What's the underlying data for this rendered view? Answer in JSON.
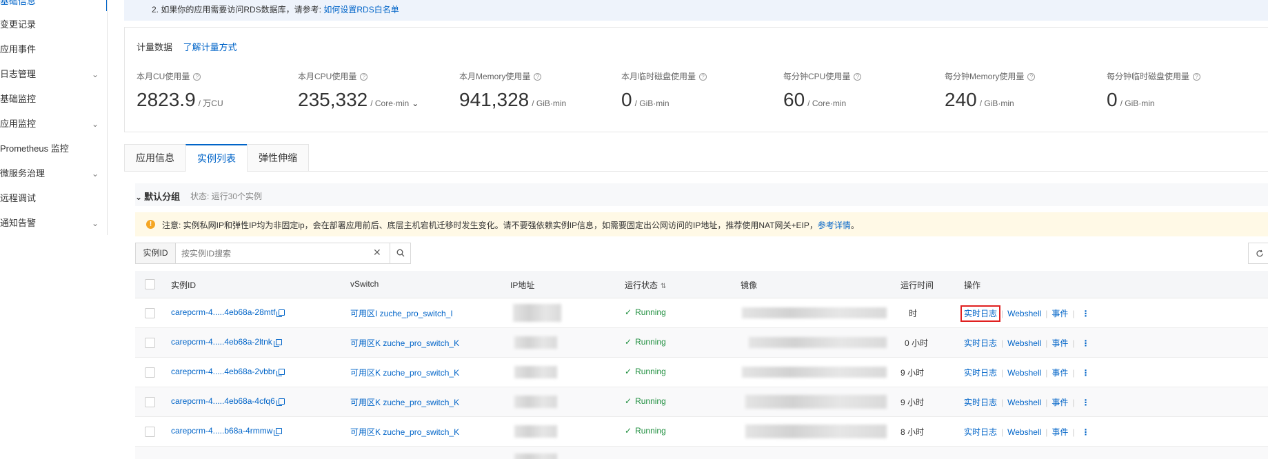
{
  "sidebar": {
    "items": [
      {
        "label": "基础信息"
      },
      {
        "label": "变更记录"
      },
      {
        "label": "应用事件"
      },
      {
        "label": "日志管理",
        "has_children": true
      },
      {
        "label": "基础监控"
      },
      {
        "label": "应用监控",
        "has_children": true
      },
      {
        "label": "Prometheus 监控"
      },
      {
        "label": "微服务治理",
        "has_children": true
      },
      {
        "label": "远程调试"
      },
      {
        "label": "通知告警",
        "has_children": true
      }
    ]
  },
  "notice": {
    "line2_text": "2. 如果你的应用需要访问RDS数据库，请参考:",
    "line2_link": "如何设置RDS白名单"
  },
  "metering": {
    "title": "计量数据",
    "link": "了解计量方式",
    "metrics": [
      {
        "label": "本月CU使用量",
        "value": "2823.9",
        "unit": "/ 万CU"
      },
      {
        "label": "本月CPU使用量",
        "value": "235,332",
        "unit": "/ Core·min"
      },
      {
        "label": "本月Memory使用量",
        "value": "941,328",
        "unit": "/ GiB·min"
      },
      {
        "label": "本月临时磁盘使用量",
        "value": "0",
        "unit": "/ GiB·min"
      },
      {
        "label": "每分钟CPU使用量",
        "value": "60",
        "unit": "/ Core·min"
      },
      {
        "label": "每分钟Memory使用量",
        "value": "240",
        "unit": "/ GiB·min"
      },
      {
        "label": "每分钟临时磁盘使用量",
        "value": "0",
        "unit": "/ GiB·min"
      }
    ]
  },
  "tabs": [
    {
      "label": "应用信息"
    },
    {
      "label": "实例列表",
      "active": true
    },
    {
      "label": "弹性伸缩"
    }
  ],
  "group": {
    "name": "默认分组",
    "status": "状态: 运行30个实例"
  },
  "warning": {
    "text": "注意: 实例私网IP和弹性IP均为非固定ip，会在部署应用前后、底层主机宕机迁移时发生变化。请不要强依赖实例IP信息，如需要固定出公网访问的IP地址，推荐使用NAT网关+EIP，",
    "link": "参考详情",
    "tail": "。"
  },
  "search": {
    "type_label": "实例ID",
    "placeholder": "按实例ID搜索",
    "value": ""
  },
  "table": {
    "columns": {
      "id": "实例ID",
      "vswitch": "vSwitch",
      "ip": "IP地址",
      "status": "运行状态",
      "image": "镜像",
      "runtime": "运行时间",
      "actions": "操作"
    },
    "action_labels": {
      "log": "实时日志",
      "webshell": "Webshell",
      "event": "事件"
    },
    "rows": [
      {
        "id": "carepcrm-4.....4eb68a-28mtf",
        "vswitch": "可用区I zuche_pro_switch_I",
        "status": "Running",
        "runtime": "时"
      },
      {
        "id": "carepcrm-4.....4eb68a-2ltnk",
        "vswitch": "可用区K zuche_pro_switch_K",
        "status": "Running",
        "runtime": "0 小时"
      },
      {
        "id": "carepcrm-4.....4eb68a-2vbbr",
        "vswitch": "可用区K zuche_pro_switch_K",
        "status": "Running",
        "runtime": "9 小时"
      },
      {
        "id": "carepcrm-4.....4eb68a-4cfq6",
        "vswitch": "可用区K zuche_pro_switch_K",
        "status": "Running",
        "runtime": "9 小时"
      },
      {
        "id": "carepcrm-4.....b68a-4rmmw",
        "vswitch": "可用区K zuche_pro_switch_K",
        "status": "Running",
        "runtime": "8 小时"
      }
    ]
  },
  "colors": {
    "accent": "#0064c8",
    "running": "#1e8e3e",
    "highlight": "#e02020",
    "warning_bg": "#fff9e6"
  }
}
